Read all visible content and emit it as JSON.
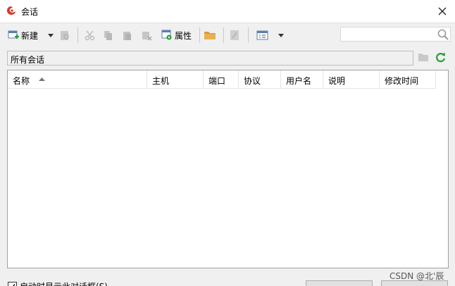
{
  "window": {
    "title": "会话",
    "close_glyph": "✕"
  },
  "toolbar": {
    "new_label": "新建",
    "properties_label": "属性"
  },
  "path": {
    "text": "所有会话"
  },
  "columns": [
    {
      "label": "名称"
    },
    {
      "label": "主机"
    },
    {
      "label": "端口"
    },
    {
      "label": "协议"
    },
    {
      "label": "用户名"
    },
    {
      "label": "说明"
    },
    {
      "label": "修改时间"
    }
  ],
  "footer": {
    "startup_checkbox_label": "启动时显示此对话框(S)"
  },
  "watermark": "CSDN @北'辰",
  "colors": {
    "accent_green": "#2a9a3a",
    "folder": "#d89a3a",
    "logo_red": "#d93a2a"
  },
  "icons": [
    "app-logo-icon",
    "close-icon",
    "new-session-icon",
    "dropdown-arrow-icon",
    "search-icon",
    "refresh-icon",
    "folder-icon",
    "properties-icon",
    "view-icon"
  ]
}
